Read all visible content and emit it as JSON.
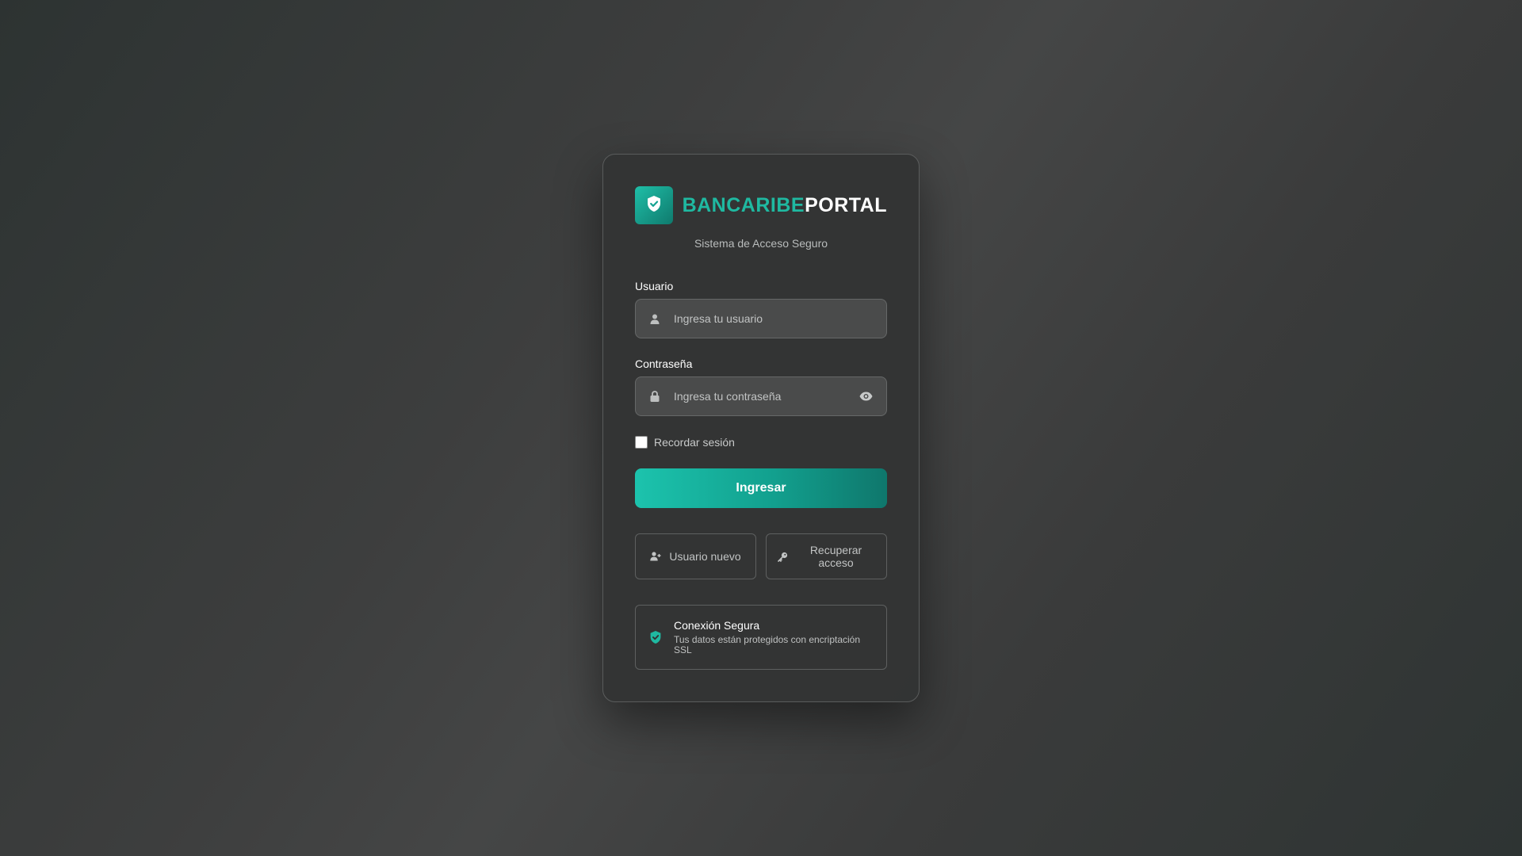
{
  "brand": {
    "name_part1": "BANCARIBE",
    "name_part2": "PORTAL",
    "logo_icon": "shield-check-icon",
    "subtitle": "Sistema de Acceso Seguro"
  },
  "form": {
    "username": {
      "label": "Usuario",
      "placeholder": "Ingresa tu usuario",
      "value": "",
      "icon": "user-icon"
    },
    "password": {
      "label": "Contraseña",
      "placeholder": "Ingresa tu contraseña",
      "value": "",
      "icon": "lock-icon",
      "toggle_icon": "eye-icon"
    },
    "remember": {
      "label": "Recordar sesión",
      "checked": false
    },
    "submit_label": "Ingresar"
  },
  "actions": {
    "new_user": {
      "label": "Usuario nuevo",
      "icon": "user-plus-icon"
    },
    "recover": {
      "label": "Recuperar acceso",
      "icon": "key-icon"
    }
  },
  "security": {
    "title": "Conexión Segura",
    "description": "Tus datos están protegidos con encriptación SSL",
    "icon": "shield-check-icon"
  },
  "colors": {
    "accent": "#1fb9a1",
    "accent_dark": "#0f776c",
    "card_bg": "#323333",
    "field_bg": "#4a4b4b"
  }
}
